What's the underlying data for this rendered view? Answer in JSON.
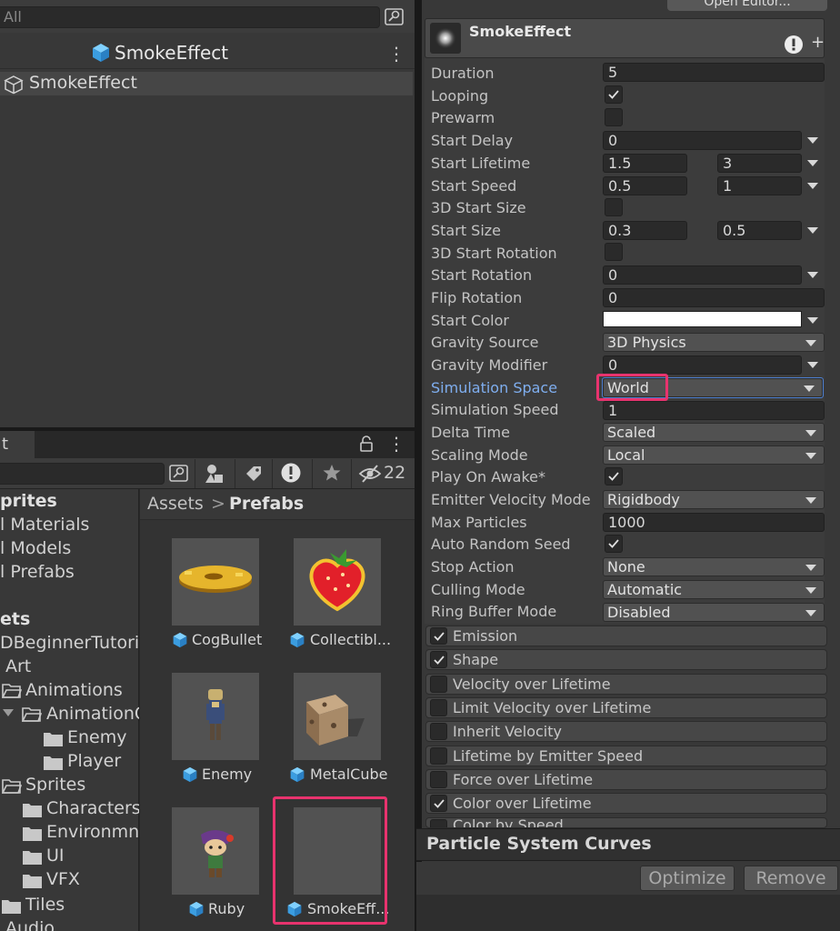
{
  "hierarchy": {
    "search_placeholder": "All",
    "scene_title": "SmokeEffect",
    "root_item": "SmokeEffect"
  },
  "project": {
    "tab_label": "t",
    "hidden_count": "22",
    "folders": [
      {
        "label": "prites",
        "bold": true
      },
      {
        "label": "l Materials"
      },
      {
        "label": "l Models"
      },
      {
        "label": "l Prefabs"
      },
      {
        "label": "ets",
        "bold": true
      },
      {
        "label": "DBeginnerTutoria"
      },
      {
        "label": "Art"
      },
      {
        "label": "Animations"
      },
      {
        "label": "AnimationC"
      },
      {
        "label": "Enemy"
      },
      {
        "label": "Player"
      },
      {
        "label": "Sprites"
      },
      {
        "label": "Characters"
      },
      {
        "label": "Environmne"
      },
      {
        "label": "UI"
      },
      {
        "label": "VFX"
      },
      {
        "label": "Tiles"
      },
      {
        "label": "Audio"
      }
    ],
    "breadcrumb": {
      "root": "Assets",
      "separator": ">",
      "current": "Prefabs"
    },
    "assets": [
      {
        "label": "CogBullet"
      },
      {
        "label": "Collectibl..."
      },
      {
        "label": "Enemy"
      },
      {
        "label": "MetalCube"
      },
      {
        "label": "Ruby"
      },
      {
        "label": "SmokeEff..."
      }
    ]
  },
  "inspector": {
    "open_editor_label": "Open Editor...",
    "component_title": "SmokeEffect",
    "properties": [
      {
        "label": "Duration",
        "value": "5"
      },
      {
        "label": "Looping",
        "checked": true
      },
      {
        "label": "Prewarm",
        "checked": false
      },
      {
        "label": "Start Delay",
        "value": "0"
      },
      {
        "label": "Start Lifetime",
        "min": "1.5",
        "max": "3"
      },
      {
        "label": "Start Speed",
        "min": "0.5",
        "max": "1"
      },
      {
        "label": "3D Start Size",
        "checked": false
      },
      {
        "label": "Start Size",
        "min": "0.3",
        "max": "0.5"
      },
      {
        "label": "3D Start Rotation",
        "checked": false
      },
      {
        "label": "Start Rotation",
        "value": "0"
      },
      {
        "label": "Flip Rotation",
        "value": "0"
      },
      {
        "label": "Start Color",
        "color": "#ffffff"
      },
      {
        "label": "Gravity Source",
        "option": "3D Physics"
      },
      {
        "label": "Gravity Modifier",
        "value": "0"
      },
      {
        "label": "Simulation Space",
        "option": "World"
      },
      {
        "label": "Simulation Speed",
        "value": "1"
      },
      {
        "label": "Delta Time",
        "option": "Scaled"
      },
      {
        "label": "Scaling Mode",
        "option": "Local"
      },
      {
        "label": "Play On Awake*",
        "checked": true
      },
      {
        "label": "Emitter Velocity Mode",
        "option": "Rigidbody"
      },
      {
        "label": "Max Particles",
        "value": "1000"
      },
      {
        "label": "Auto Random Seed",
        "checked": true
      },
      {
        "label": "Stop Action",
        "option": "None"
      },
      {
        "label": "Culling Mode",
        "option": "Automatic"
      },
      {
        "label": "Ring Buffer Mode",
        "option": "Disabled"
      }
    ],
    "modules": [
      {
        "label": "Emission",
        "checked": true
      },
      {
        "label": "Shape",
        "checked": true
      },
      {
        "label": "Velocity over Lifetime",
        "checked": false
      },
      {
        "label": "Limit Velocity over Lifetime",
        "checked": false
      },
      {
        "label": "Inherit Velocity",
        "checked": false
      },
      {
        "label": "Lifetime by Emitter Speed",
        "checked": false
      },
      {
        "label": "Force over Lifetime",
        "checked": false
      },
      {
        "label": "Color over Lifetime",
        "checked": true
      },
      {
        "label": "Color by Speed",
        "checked": false
      }
    ],
    "curves_title": "Particle System Curves",
    "optimize_label": "Optimize",
    "remove_label": "Remove"
  },
  "colors": {
    "highlight": "#e8336e",
    "accent_label": "#7faeef",
    "cube": "#4fb0f0"
  }
}
